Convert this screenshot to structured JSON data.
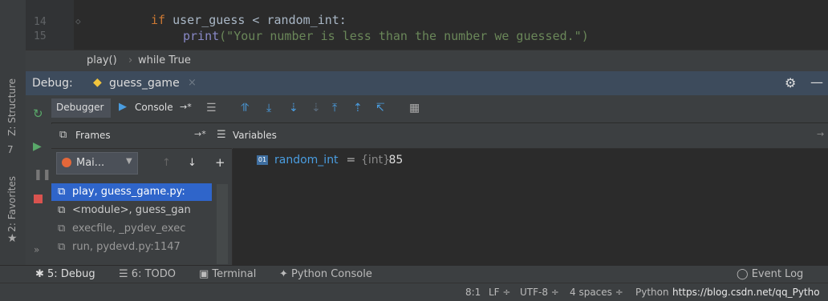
{
  "editor": {
    "lines": [
      {
        "num": "14",
        "kw": "if",
        "code": " user_guess < random_int:"
      },
      {
        "num": "15",
        "fn": "print",
        "str": "(\"Your number is less than the number we guessed.\")"
      }
    ]
  },
  "breadcrumb": [
    "play()",
    "while True"
  ],
  "debug": {
    "label": "Debug:",
    "tab": "guess_game",
    "tab_close": "×",
    "gear": "⚙",
    "minimize": "—"
  },
  "toolbar": {
    "debugger": "Debugger",
    "console": "Console",
    "console_arrow": "→*"
  },
  "side_tabs": {
    "structure": "Z: Structure",
    "structure_key": "7",
    "favorites": "2: Favorites"
  },
  "frames": {
    "header": "Frames",
    "arrow": "→*",
    "thread": "Mai...",
    "items": [
      "play, guess_game.py:",
      "<module>, guess_gan",
      "execfile, _pydev_exec",
      "run, pydevd.py:1147"
    ]
  },
  "variables": {
    "header": "Variables",
    "items": [
      {
        "name": "random_int",
        "eq": " = ",
        "type": "{int}",
        "value": " 85"
      }
    ]
  },
  "bottom_tabs": {
    "debug": "5: Debug",
    "todo": "6: TODO",
    "terminal": "Terminal",
    "python_console": "Python Console",
    "event_log": "Event Log"
  },
  "status": {
    "position": "8:1",
    "line_sep": "LF ÷",
    "encoding": "UTF-8 ÷",
    "indent": "4 spaces ÷",
    "interpreter": "Python",
    "watermark": "https://blog.csdn.net/qq_Pytho"
  },
  "colors": {
    "accent": "#4a9de0",
    "selected": "#2f65ca",
    "background": "#3c3f41"
  }
}
